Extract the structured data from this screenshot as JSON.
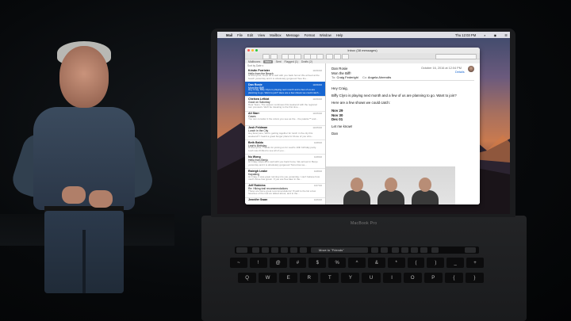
{
  "menubar": {
    "app": "Mail",
    "items": [
      "File",
      "Edit",
      "View",
      "Mailbox",
      "Message",
      "Format",
      "Window",
      "Help"
    ],
    "clock": "Thu 12:03 PM"
  },
  "window": {
    "title": "Inbox (38 messages)",
    "favorites": [
      "Mailboxes",
      "Inbox",
      "Sent",
      "Flagged (1)",
      "Drafts (2)"
    ]
  },
  "list": {
    "sort_label": "Sort by Date ▾",
    "messages": [
      {
        "from": "Kristin Forrister",
        "subject": "Hello from the Beach",
        "preview": "Hi Everyone, Hope all is well with you back home! We arrived at the beach yesterday and it is absolutely gorgeous! See the…",
        "date": "10/16/16"
      },
      {
        "from": "Dan Rosie",
        "subject": "Mom the Biff!",
        "preview": "Hey Craig, Biffy Clyro is playing next month and a few of us are planning to go. Want to join? Here are a few shows we could catch…",
        "date": "10/16/16"
      },
      {
        "from": "Chelsea Lefkiat",
        "subject": "Good on Saturday",
        "preview": "Dear Team, The season continues this weekend with the regional tour previews. We'll be traveling to the first time…",
        "date": "10/16/16"
      },
      {
        "from": "Ali Starr",
        "subject": "Cases",
        "preview": "You can consider it the colors you see as the…the palette™ and…",
        "date": "10/15/16"
      },
      {
        "from": "Josh Feldman",
        "subject": "Lunch in the City",
        "preview": "Hey Everyone, We're getting together for lunch in the city this weekend? I heard a great burger place for those of you who…",
        "date": "10/15/16"
      },
      {
        "from": "Beth Baldo",
        "subject": "Leah's Birthday",
        "preview": "Hi Everyone, Thanks for joining us for Leah's 10th birthday party. Leah was thrilled to see all of you…",
        "date": "10/8/16"
      },
      {
        "from": "Nu Wong",
        "subject": "Hello from Benjo",
        "preview": "Hi Craig, Hope all is well with you back home. We arrived in Benjo yesterday and it is absolutely gorgeous! Tomorrow we…",
        "date": "10/8/16"
      },
      {
        "from": "Raleigh Leake",
        "subject": "Kayaking",
        "preview": "Hi Craig, It was great running into you yesterday. I can't believe how much those has grown. If you are free later in the…",
        "date": "10/8/16"
      },
      {
        "from": "Jeff Robbins",
        "subject": "Re: Hiking trail recommendations",
        "preview": "These are some great recommendations! I'll add to the list a few favorites of the trail we talked about, and to the…",
        "date": "10/7/16"
      },
      {
        "from": "Jennifer Swan",
        "subject": "",
        "preview": "",
        "date": "10/6/16"
      }
    ]
  },
  "reader": {
    "from": "Dan Rosie",
    "flag": "#",
    "date": "October 16, 2016 at 12:04 PM",
    "details": "Details",
    "subject": "Mon the Biff!",
    "to_label": "To:",
    "to_name": "Craig Federighi",
    "cc_label": "Cc:",
    "cc_name": "Angela Ahrendts",
    "greeting": "Hey Craig,",
    "line1": "Biffy Clyro is playing next month and a few of us are planning to go.  Want to join?",
    "line2": "Here are a few shows we could catch:",
    "dates": [
      "Nov 29",
      "Nov 30",
      "Dec 01"
    ],
    "line3": "Let me know!",
    "signoff": "Dan"
  },
  "laptop": {
    "model": "MacBook Pro",
    "touchbar_suggestion": "Move to \"Friends\"",
    "keys_row1": [
      "~",
      "!",
      "@",
      "#",
      "$",
      "%",
      "^",
      "&",
      "*",
      "(",
      ")",
      "_",
      "+"
    ],
    "keys_row2": [
      "Q",
      "W",
      "E",
      "R",
      "T",
      "Y",
      "U",
      "I",
      "O",
      "P",
      "{",
      "}"
    ]
  }
}
